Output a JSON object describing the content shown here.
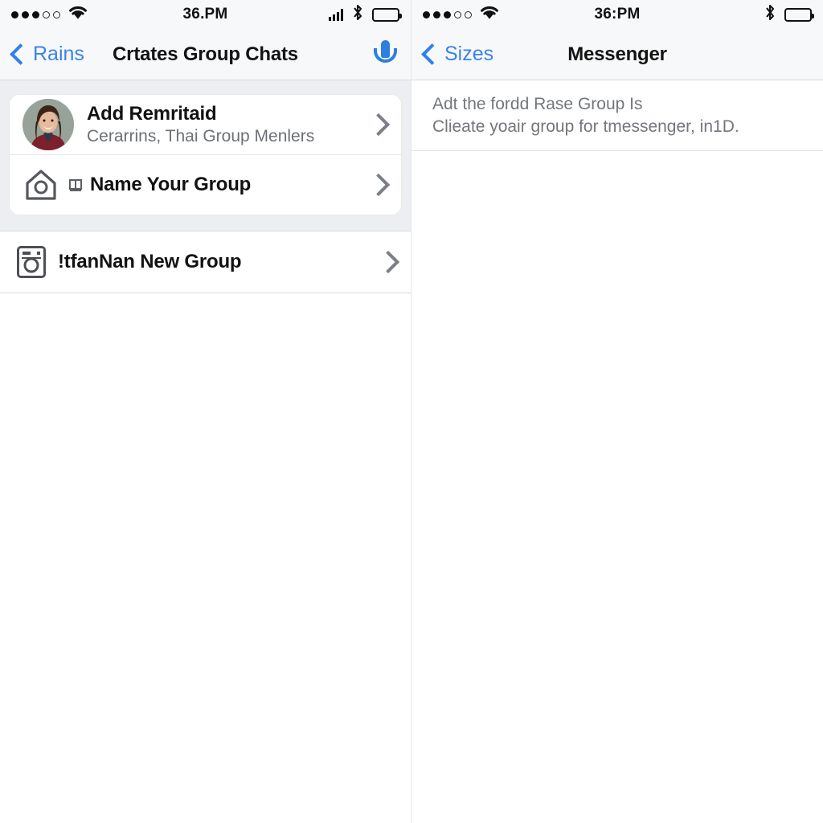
{
  "left": {
    "status_bar": {
      "signal_dots_filled": 3,
      "signal_dots_total": 5,
      "wifi_icon": "wifi-icon",
      "time": "36.PM",
      "cell_bars_icon": "cellular-bars-icon",
      "bluetooth_icon": "bluetooth-icon",
      "battery_icon": "battery-full-icon"
    },
    "nav": {
      "back_label": "Rains",
      "title": "Crtates Group Chats",
      "action_icon": "microphone-icon"
    },
    "card_rows": [
      {
        "title": "Add Remritaid",
        "subtitle": "Cerarrins, Thai Group Menlers",
        "leading": "avatar-photo",
        "chevron": "chevron-right-icon"
      },
      {
        "title": "Name Your Group",
        "subtitle": "",
        "leading": "house-camera-icon",
        "mini_glyph": "small-badge-icon",
        "chevron": "chevron-right-icon"
      }
    ],
    "standalone_row": {
      "title": "!tfanNan New Group",
      "leading": "washer-camera-icon",
      "chevron": "chevron-right-icon"
    }
  },
  "right": {
    "status_bar": {
      "signal_dots_filled": 3,
      "signal_dots_total": 5,
      "wifi_icon": "wifi-icon",
      "time": "36:PM",
      "bluetooth_icon": "bluetooth-icon",
      "battery_icon": "battery-full-icon"
    },
    "nav": {
      "back_label": "Sizes",
      "title": "Messenger"
    },
    "info": {
      "line1": "Adt the fordd Rase Group Is",
      "line2": "Clieate yoair group for tmessenger, in1D."
    }
  },
  "colors": {
    "accent_blue": "#2f80ef",
    "status_bg": "#f7f8f9",
    "group_bg": "#eceef1",
    "text_primary": "#121212",
    "text_secondary": "#6c7177",
    "separator": "#d9dce0"
  }
}
